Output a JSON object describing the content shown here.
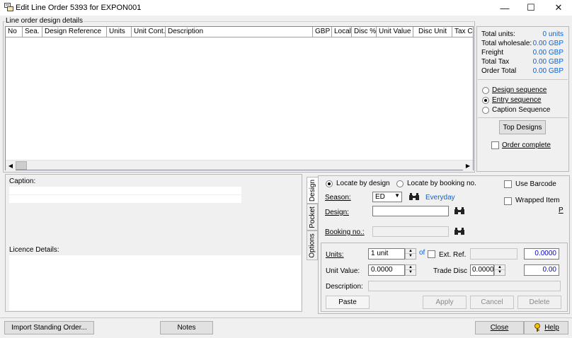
{
  "window": {
    "title": "Edit Line Order 5393 for EXPON001",
    "minimize_glyph": "—",
    "maximize_glyph": "☐",
    "close_glyph": "✕"
  },
  "design_details": {
    "group_label": "Line order design details",
    "columns": [
      "No",
      "Sea.",
      "Design Reference",
      "Units",
      "Unit Cont.",
      "Description",
      "GBP",
      "Local",
      "Disc %",
      "Unit Value",
      "Disc Unit",
      "Tax Co"
    ],
    "rows": []
  },
  "totals": {
    "total_units_label": "Total units:",
    "total_units_value": "0 units",
    "total_wholesale_label": "Total wholesale:",
    "total_wholesale_value": "0.00 GBP",
    "freight_label": "Freight",
    "freight_value": "0.00 GBP",
    "total_tax_label": "Total Tax",
    "total_tax_value": "0.00 GBP",
    "order_total_label": "Order Total",
    "order_total_value": "0.00 GBP"
  },
  "sequence": {
    "design_sequence_label": "Design sequence",
    "entry_sequence_label": "Entry sequence",
    "caption_sequence_label": "Caption Sequence",
    "selected": "entry"
  },
  "top_designs_label": "Top Designs",
  "order_complete_label": "Order complete",
  "caption": {
    "caption_label": "Caption:",
    "licence_label": "Licence Details:"
  },
  "tabs": [
    "Design",
    "Pocket",
    "Options"
  ],
  "locate": {
    "by_design_label": "Locate by design",
    "by_booking_label": "Locate by booking no.",
    "selected": "design",
    "use_barcode_label": "Use Barcode",
    "wrapped_item_label": "Wrapped Item",
    "p_label": "P"
  },
  "fields": {
    "season_label": "Season:",
    "season_value": "ED",
    "season_name": "Everyday",
    "design_label": "Design:",
    "design_value": "",
    "booking_label": "Booking no.:",
    "booking_value": "",
    "units_label": "Units:",
    "units_value": "1 unit",
    "of_label": "of",
    "ext_ref_label": "Ext. Ref.",
    "ext_ref_value": "",
    "ext_amount_value": "0.0000",
    "unit_value_label": "Unit Value:",
    "unit_value": "0.0000",
    "trade_disc_label": "Trade Disc",
    "trade_disc_value": "0.0000",
    "trade_amount_value": "0.00",
    "description_label": "Description:",
    "description_value": ""
  },
  "actions": {
    "paste": "Paste",
    "apply": "Apply",
    "cancel": "Cancel",
    "delete": "Delete"
  },
  "footer": {
    "import_label": "Import Standing Order...",
    "notes_label": "Notes",
    "close_label": "Close",
    "help_label": "Help"
  },
  "colors": {
    "accent_value": "#0a64d8",
    "number_blue": "#0000c8"
  },
  "icons": [
    "window-app-icon",
    "binoculars-icon",
    "help-key-icon"
  ]
}
